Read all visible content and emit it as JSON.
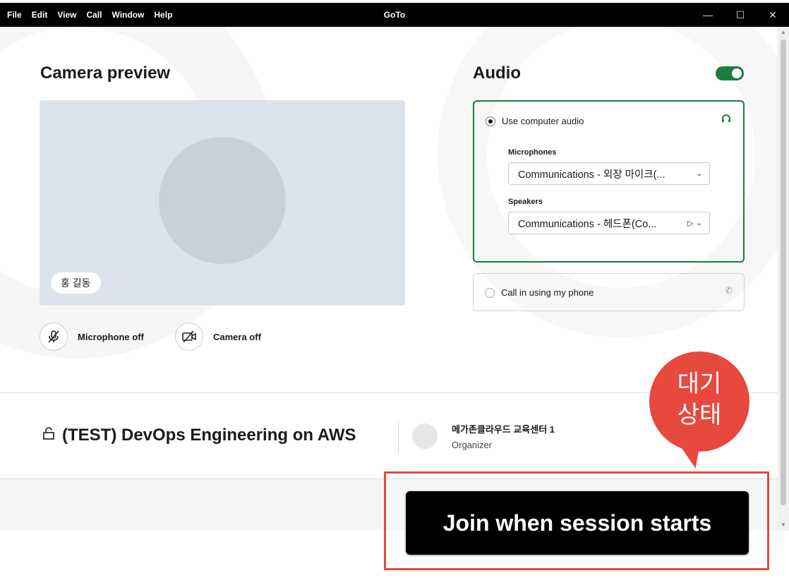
{
  "window": {
    "title": "GoTo",
    "menu": [
      "File",
      "Edit",
      "View",
      "Call",
      "Window",
      "Help"
    ],
    "controls": [
      "minimize",
      "maximize",
      "close"
    ]
  },
  "camera": {
    "heading": "Camera preview",
    "user_name": "홍 길동",
    "mic_label": "Microphone off",
    "cam_label": "Camera off"
  },
  "audio": {
    "heading": "Audio",
    "enabled": true,
    "computer_audio": {
      "label": "Use computer audio",
      "selected": true,
      "microphones_label": "Microphones",
      "microphone_value": "Communications - 외장 마이크(...",
      "speakers_label": "Speakers",
      "speaker_value": "Communications - 헤드폰(Co..."
    },
    "phone": {
      "label": "Call in using my phone",
      "selected": false
    }
  },
  "meeting": {
    "title": "(TEST) DevOps Engineering on AWS",
    "organizer_name": "메가존클라우드 교육센터 1",
    "organizer_role": "Organizer"
  },
  "join_button": "Join when session starts",
  "annotation": {
    "callout": [
      "대기",
      "상태"
    ],
    "color": "#e8493e"
  },
  "colors": {
    "accent_green": "#1c7c3f",
    "preview_bg": "#dde3ea"
  }
}
